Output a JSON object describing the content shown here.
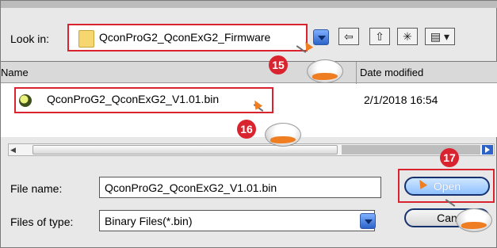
{
  "dialog": {
    "look_in_label": "Look in:",
    "look_in_value": "QconProG2_QconExG2_Firmware",
    "toolbar_icons": [
      "back-icon",
      "up-folder-icon",
      "new-folder-icon",
      "view-menu-icon"
    ]
  },
  "list": {
    "columns": {
      "name": "Name",
      "date_modified": "Date modified"
    },
    "rows": [
      {
        "name": "QconProG2_QconExG2_V1.01.bin",
        "date": "2/1/2018 16:54"
      }
    ]
  },
  "fields": {
    "file_name_label": "File name:",
    "file_name_value": "QconProG2_QconExG2_V1.01.bin",
    "file_type_label": "Files of type:",
    "file_type_value": "Binary Files(*.bin)"
  },
  "buttons": {
    "open": "Open",
    "cancel": "Can"
  },
  "steps": {
    "s15": "15",
    "s16": "16",
    "s17": "17"
  },
  "colors": {
    "highlight": "#d9232e",
    "accent_blue": "#2c63c8",
    "cursor": "#ef7d22"
  }
}
